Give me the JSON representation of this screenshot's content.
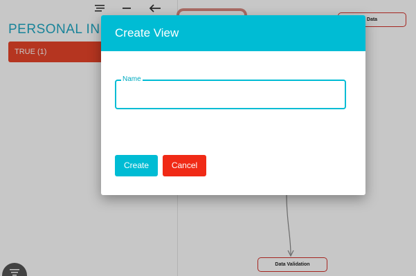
{
  "left_panel": {
    "section_title": "PERSONAL INFOR",
    "filter_chip_label": "TRUE (1)",
    "toolbar_icons": [
      "sort-lines-icon",
      "minus-icon",
      "arrow-left-icon"
    ],
    "fab_icon": "menu-lines-icon"
  },
  "canvas": {
    "nodes": {
      "data_label": "Data",
      "validation_label": "Data Validation"
    }
  },
  "dialog": {
    "title": "Create View",
    "name_field": {
      "label": "Name",
      "value": "",
      "placeholder": ""
    },
    "create_label": "Create",
    "cancel_label": "Cancel"
  },
  "colors": {
    "accent": "#00bcd4",
    "danger": "#f02a16",
    "chip": "#e8452a",
    "title_text": "#1fa8c4",
    "node_border": "#d4302a"
  }
}
